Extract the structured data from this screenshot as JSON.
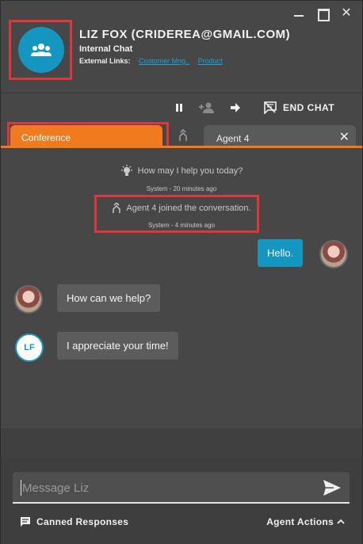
{
  "header": {
    "contact_name": "LIZ FOX (CRIDEREA@GMAIL.COM)",
    "chat_type": "Internal Chat",
    "external_links_label": "External Links:",
    "links": [
      "Customer Mng..",
      "Product"
    ]
  },
  "toolbar": {
    "end_chat_label": "END CHAT"
  },
  "tabs": [
    {
      "label": "Conference",
      "active": true
    },
    {
      "label": "Agent 4",
      "active": false
    }
  ],
  "system_messages": [
    {
      "text": "How may I help you today?",
      "meta": "System - 20 minutes ago"
    },
    {
      "text": "Agent 4 joined the conversation.",
      "meta": "System - 4 minutes ago"
    }
  ],
  "messages": [
    {
      "direction": "out",
      "text": "Hello."
    },
    {
      "direction": "in",
      "text": "How can we help?"
    },
    {
      "direction": "in",
      "text": "I appreciate your time!",
      "initials": "LF"
    }
  ],
  "composer": {
    "placeholder": "Message Liz",
    "canned_label": "Canned Responses",
    "agent_actions_label": "Agent Actions"
  },
  "colors": {
    "accent_orange": "#f07b1f",
    "accent_blue": "#1596c1",
    "highlight_red": "#e0353a"
  }
}
